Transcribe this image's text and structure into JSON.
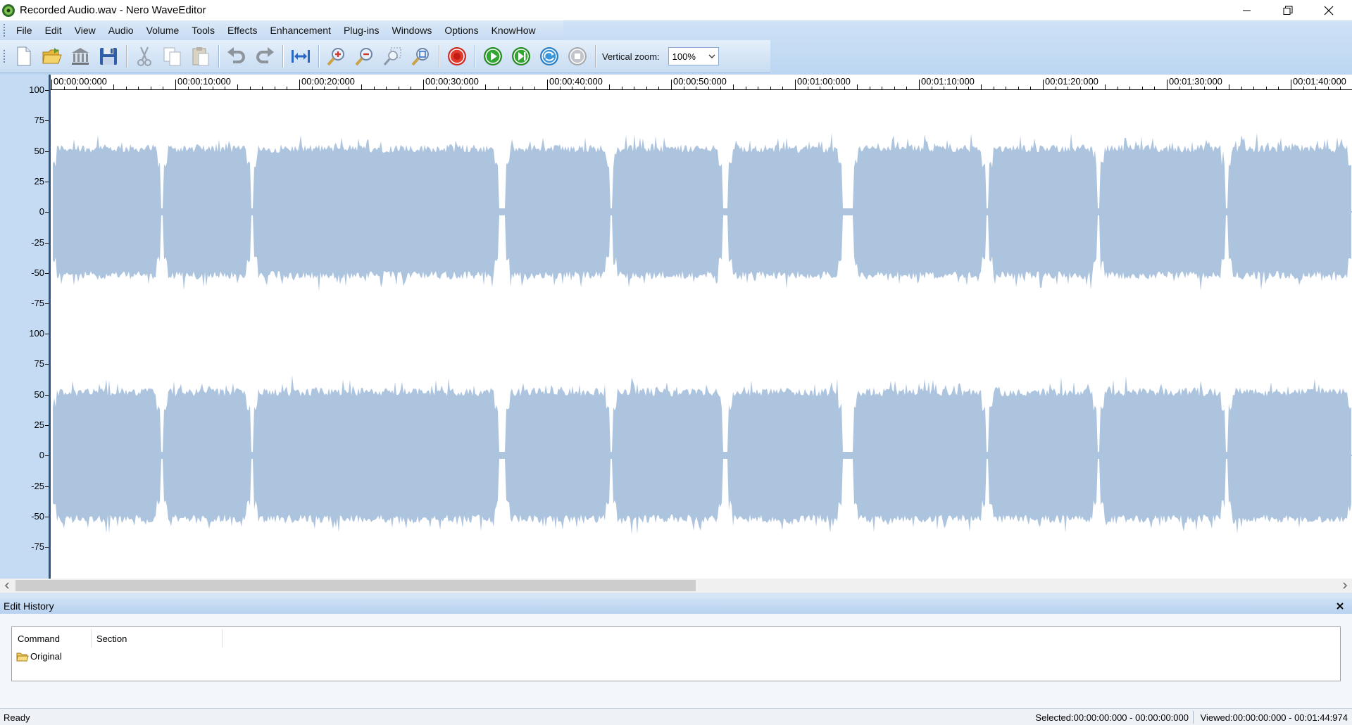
{
  "window": {
    "title": "Recorded Audio.wav - Nero WaveEditor",
    "app_icon": "nero-logo-icon",
    "controls": [
      "minimize-icon",
      "restore-icon",
      "close-icon"
    ]
  },
  "menu": {
    "items": [
      "File",
      "Edit",
      "View",
      "Audio",
      "Volume",
      "Tools",
      "Effects",
      "Enhancement",
      "Plug-ins",
      "Windows",
      "Options",
      "KnowHow"
    ]
  },
  "toolbar": {
    "buttons": [
      {
        "icon": "new-file-icon"
      },
      {
        "icon": "open-folder-icon"
      },
      {
        "icon": "library-icon"
      },
      {
        "icon": "save-icon"
      },
      {
        "icon": "cut-icon"
      },
      {
        "icon": "copy-icon"
      },
      {
        "icon": "paste-icon"
      },
      {
        "icon": "undo-icon"
      },
      {
        "icon": "redo-icon"
      },
      {
        "icon": "fit-to-window-icon"
      },
      {
        "icon": "zoom-in-icon"
      },
      {
        "icon": "zoom-out-icon"
      },
      {
        "icon": "zoom-selection-icon"
      },
      {
        "icon": "zoom-full-icon"
      },
      {
        "icon": "record-icon"
      },
      {
        "icon": "play-icon"
      },
      {
        "icon": "play-selection-icon"
      },
      {
        "icon": "loop-icon"
      },
      {
        "icon": "stop-icon"
      }
    ],
    "vertical_zoom_label": "Vertical zoom:",
    "vertical_zoom_value": "100%"
  },
  "colors": {
    "waveform": "#adc4df",
    "left_scale": "#c4dbf3",
    "cursor_line": "#2c5580"
  },
  "timeline": {
    "labels": [
      "00:00:00:000",
      "00:00:10:000",
      "00:00:20:000",
      "00:00:30:000",
      "00:00:40:000",
      "00:00:50:000",
      "00:01:00:000",
      "00:01:10:000",
      "00:01:20:000",
      "00:01:30:000",
      "00:01:40:000"
    ]
  },
  "amplitude_scale": {
    "labels": [
      "100",
      "75",
      "50",
      "25",
      "0",
      "-25",
      "-50",
      "-75"
    ]
  },
  "history": {
    "title": "Edit History",
    "columns": [
      "Command",
      "Section"
    ],
    "rows": [
      {
        "command": "Original",
        "section": "",
        "icon": "folder-icon"
      }
    ]
  },
  "status": {
    "left": "Ready",
    "selected": "Selected:00:00:00:000 - 00:00:00:000",
    "viewed": "Viewed:00:00:00:000 - 00:01:44:974"
  }
}
